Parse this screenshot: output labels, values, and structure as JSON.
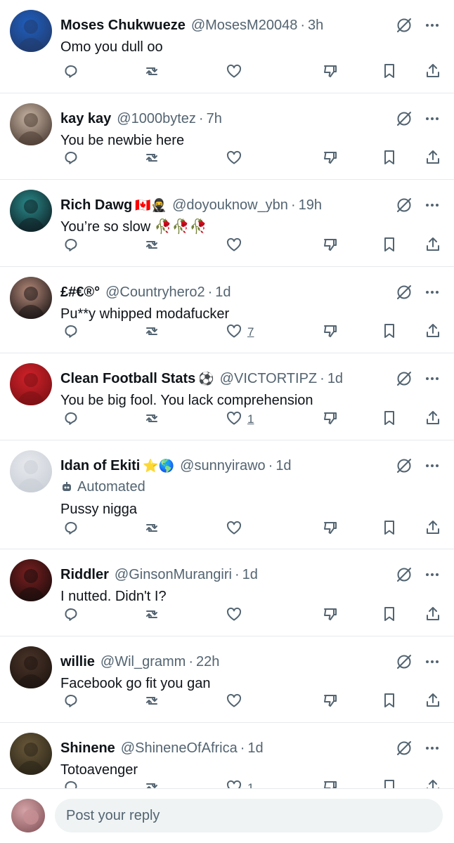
{
  "posts": [
    {
      "name": "Moses Chukwueze",
      "handle": "@MosesM20048",
      "time": "3h",
      "text": "Omo you dull oo",
      "avatar_colors": [
        "#1f5fbf",
        "#203a6b"
      ],
      "likes": ""
    },
    {
      "name": "kay kay",
      "handle": "@1000bytez",
      "time": "7h",
      "text": "You be newbie here",
      "avatar_colors": [
        "#c9b6a6",
        "#4a3a31"
      ],
      "likes": ""
    },
    {
      "name": "Rich Dawg",
      "name_emoji": "🇨🇦🥷",
      "handle": "@doyouknow_ybn",
      "time": "19h",
      "text": "You’re so slow 🥀🥀🥀",
      "avatar_colors": [
        "#2a8a8a",
        "#0e1f24"
      ],
      "likes": ""
    },
    {
      "name": "£#€®°",
      "handle": "@Countryhero2",
      "time": "1d",
      "text": "Pu**y whipped modafucker",
      "avatar_colors": [
        "#b58a7a",
        "#1a1414"
      ],
      "likes": "7"
    },
    {
      "name": "Clean Football Stats",
      "name_emoji": "⚽",
      "handle": "@VICTORTIPZ",
      "time": "1d",
      "text": "You be big fool. You lack comprehension",
      "avatar_colors": [
        "#d3222a",
        "#7a1014"
      ],
      "likes": "1"
    },
    {
      "name": "Idan of Ekiti",
      "name_emoji": "⭐🌎",
      "handle": "@sunnyirawo",
      "time": "1d",
      "label": "Automated",
      "text": "Pussy nigga",
      "avatar_colors": [
        "#e8eaee",
        "#c9ced6"
      ],
      "likes": ""
    },
    {
      "name": "Riddler",
      "handle": "@GinsonMurangiri",
      "time": "1d",
      "text": "I nutted. Didn't I?",
      "avatar_colors": [
        "#7a1f1f",
        "#1a0c0c"
      ],
      "likes": ""
    },
    {
      "name": "willie",
      "handle": "@Wil_gramm",
      "time": "22h",
      "text": "Facebook go fit you gan",
      "avatar_colors": [
        "#4a3428",
        "#1d1410"
      ],
      "likes": ""
    },
    {
      "name": "Shinene",
      "handle": "@ShineneOfAfrica",
      "time": "1d",
      "text": "Totoavenger",
      "avatar_colors": [
        "#6b5a3a",
        "#2a2418"
      ],
      "likes": "1"
    }
  ],
  "reply_bar": {
    "placeholder": "Post your reply",
    "avatar_colors": [
      "#d4a4a8",
      "#8a5a60"
    ]
  },
  "icons": {
    "reply": "reply-icon",
    "repost": "repost-icon",
    "like": "heart-icon",
    "dislike": "downvote-icon",
    "bookmark": "bookmark-icon",
    "share": "share-icon",
    "grok": "grok-icon",
    "more": "more-icon",
    "automated": "robot-icon"
  },
  "colors": {
    "text": "#0f1419",
    "secondary": "#536471",
    "divider": "#e6e9ec",
    "input_bg": "#eff3f4"
  }
}
